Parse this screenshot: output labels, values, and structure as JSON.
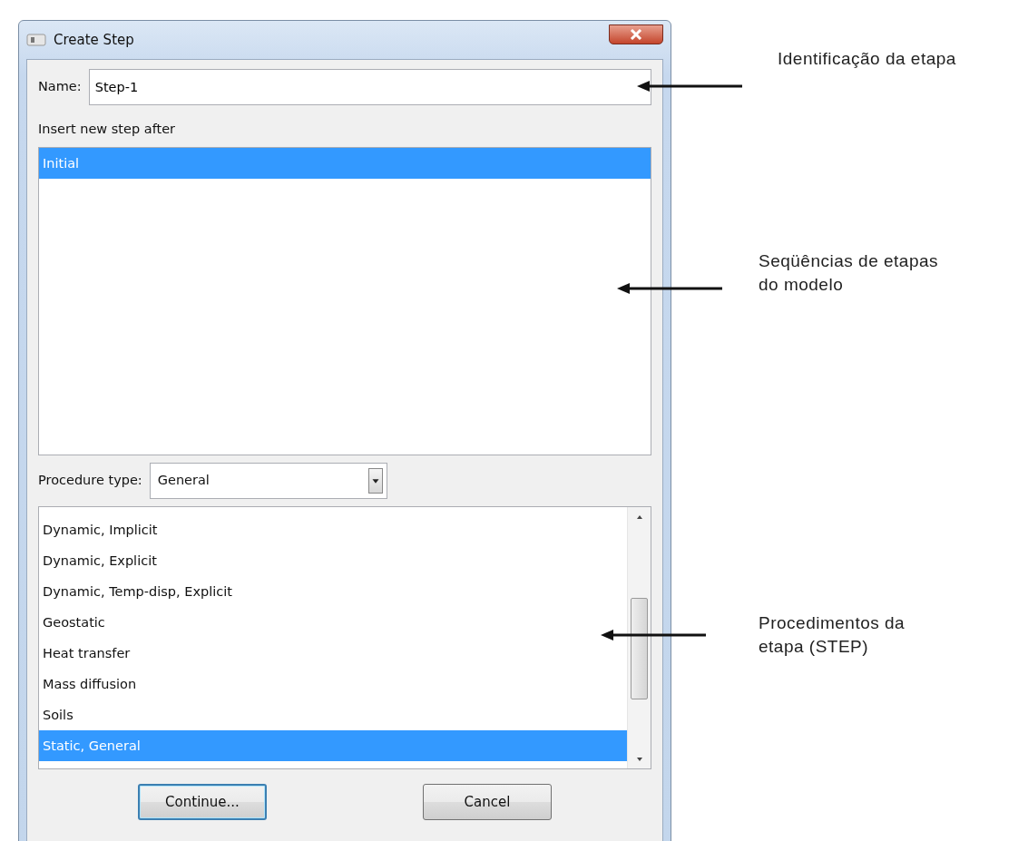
{
  "window": {
    "title": "Create Step"
  },
  "name_field": {
    "label": "Name:",
    "value": "Step-1"
  },
  "insert_label": "Insert new step after",
  "steps": [
    {
      "label": "Initial",
      "selected": true
    }
  ],
  "procedure_type": {
    "label": "Procedure type:",
    "value": "General"
  },
  "procedures": [
    {
      "label": "Dynamic, Implicit",
      "selected": false
    },
    {
      "label": "Dynamic, Explicit",
      "selected": false
    },
    {
      "label": "Dynamic, Temp-disp, Explicit",
      "selected": false
    },
    {
      "label": "Geostatic",
      "selected": false
    },
    {
      "label": "Heat transfer",
      "selected": false
    },
    {
      "label": "Mass diffusion",
      "selected": false
    },
    {
      "label": "Soils",
      "selected": false
    },
    {
      "label": "Static, General",
      "selected": true
    }
  ],
  "buttons": [
    {
      "label": "Continue...",
      "default": true
    },
    {
      "label": "Cancel",
      "default": false
    }
  ],
  "annotations": [
    {
      "text": "Identificação da etapa"
    },
    {
      "text": "Seqüências de etapas\ndo modelo"
    },
    {
      "text": "Procedimentos da\netapa (STEP)"
    }
  ]
}
